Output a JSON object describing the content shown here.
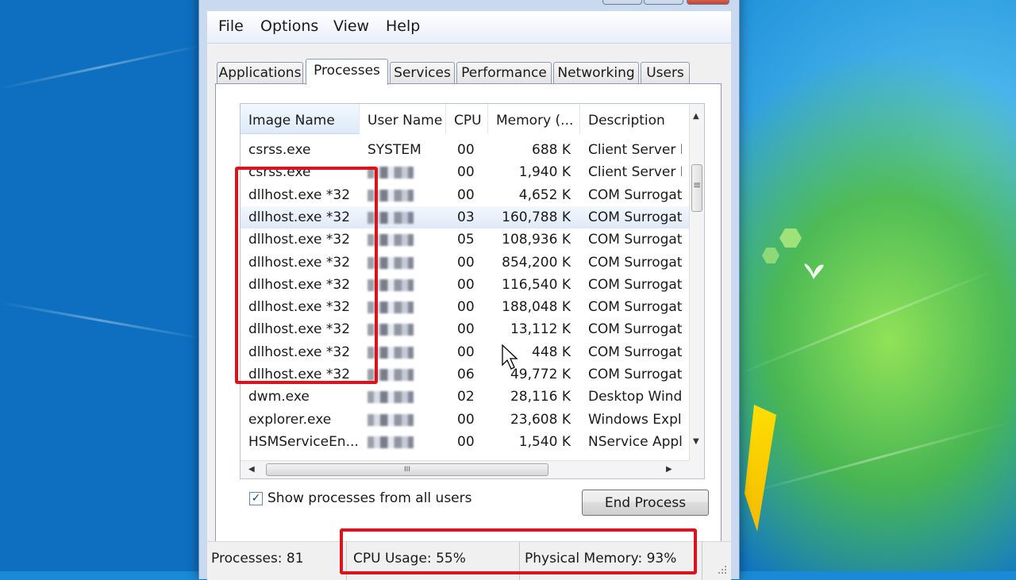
{
  "menu": {
    "items": [
      "File",
      "Options",
      "View",
      "Help"
    ]
  },
  "tabs": [
    {
      "label": "Applications",
      "active": false
    },
    {
      "label": "Processes",
      "active": true
    },
    {
      "label": "Services",
      "active": false
    },
    {
      "label": "Performance",
      "active": false
    },
    {
      "label": "Networking",
      "active": false
    },
    {
      "label": "Users",
      "active": false
    }
  ],
  "table": {
    "columns": [
      "Image Name",
      "User Name",
      "CPU",
      "Memory (...",
      "Description"
    ],
    "sort_indicator": "^",
    "rows": [
      {
        "name": "csrss.exe",
        "user": "SYSTEM",
        "cpu": "00",
        "memory": "688 K",
        "desc": "Client Server R"
      },
      {
        "name": "csrss.exe",
        "user": "",
        "cpu": "00",
        "memory": "1,940 K",
        "desc": "Client Server R"
      },
      {
        "name": "dllhost.exe *32",
        "user": "",
        "cpu": "00",
        "memory": "4,652 K",
        "desc": "COM Surrogate"
      },
      {
        "name": "dllhost.exe *32",
        "user": "",
        "cpu": "03",
        "memory": "160,788 K",
        "desc": "COM Surrogate"
      },
      {
        "name": "dllhost.exe *32",
        "user": "",
        "cpu": "05",
        "memory": "108,936 K",
        "desc": "COM Surrogate"
      },
      {
        "name": "dllhost.exe *32",
        "user": "",
        "cpu": "00",
        "memory": "854,200 K",
        "desc": "COM Surrogate"
      },
      {
        "name": "dllhost.exe *32",
        "user": "",
        "cpu": "00",
        "memory": "116,540 K",
        "desc": "COM Surrogate"
      },
      {
        "name": "dllhost.exe *32",
        "user": "",
        "cpu": "00",
        "memory": "188,048 K",
        "desc": "COM Surrogate"
      },
      {
        "name": "dllhost.exe *32",
        "user": "",
        "cpu": "00",
        "memory": "13,112 K",
        "desc": "COM Surrogate"
      },
      {
        "name": "dllhost.exe *32",
        "user": "",
        "cpu": "00",
        "memory": "448 K",
        "desc": "COM Surrogate"
      },
      {
        "name": "dllhost.exe *32",
        "user": "",
        "cpu": "06",
        "memory": "49,772 K",
        "desc": "COM Surrogate"
      },
      {
        "name": "dwm.exe",
        "user": "",
        "cpu": "02",
        "memory": "28,116 K",
        "desc": "Desktop Window"
      },
      {
        "name": "explorer.exe",
        "user": "",
        "cpu": "00",
        "memory": "23,608 K",
        "desc": "Windows Explorer"
      },
      {
        "name": "HSMServiceEn...",
        "user": "",
        "cpu": "00",
        "memory": "1,540 K",
        "desc": "NService Applic"
      }
    ],
    "selected_row": 3
  },
  "options": {
    "show_all_users_label": "Show processes from all users",
    "show_all_users_checked": true,
    "check_glyph": "✓"
  },
  "end_process_label": "End Process",
  "status": {
    "processes": "Processes: 81",
    "cpu_usage": "CPU Usage: 55%",
    "physical_memory": "Physical Memory: 93%"
  },
  "scrollbar": {
    "grip_glyph": "III",
    "left_glyph": "◀",
    "right_glyph": "▶",
    "up_glyph": "▲",
    "down_glyph": "▼",
    "vgrip_glyph": "≡"
  },
  "colors": {
    "highlight": "#d8141c",
    "selection": "#dfeaf7",
    "window_frame": "#c9daf0"
  }
}
